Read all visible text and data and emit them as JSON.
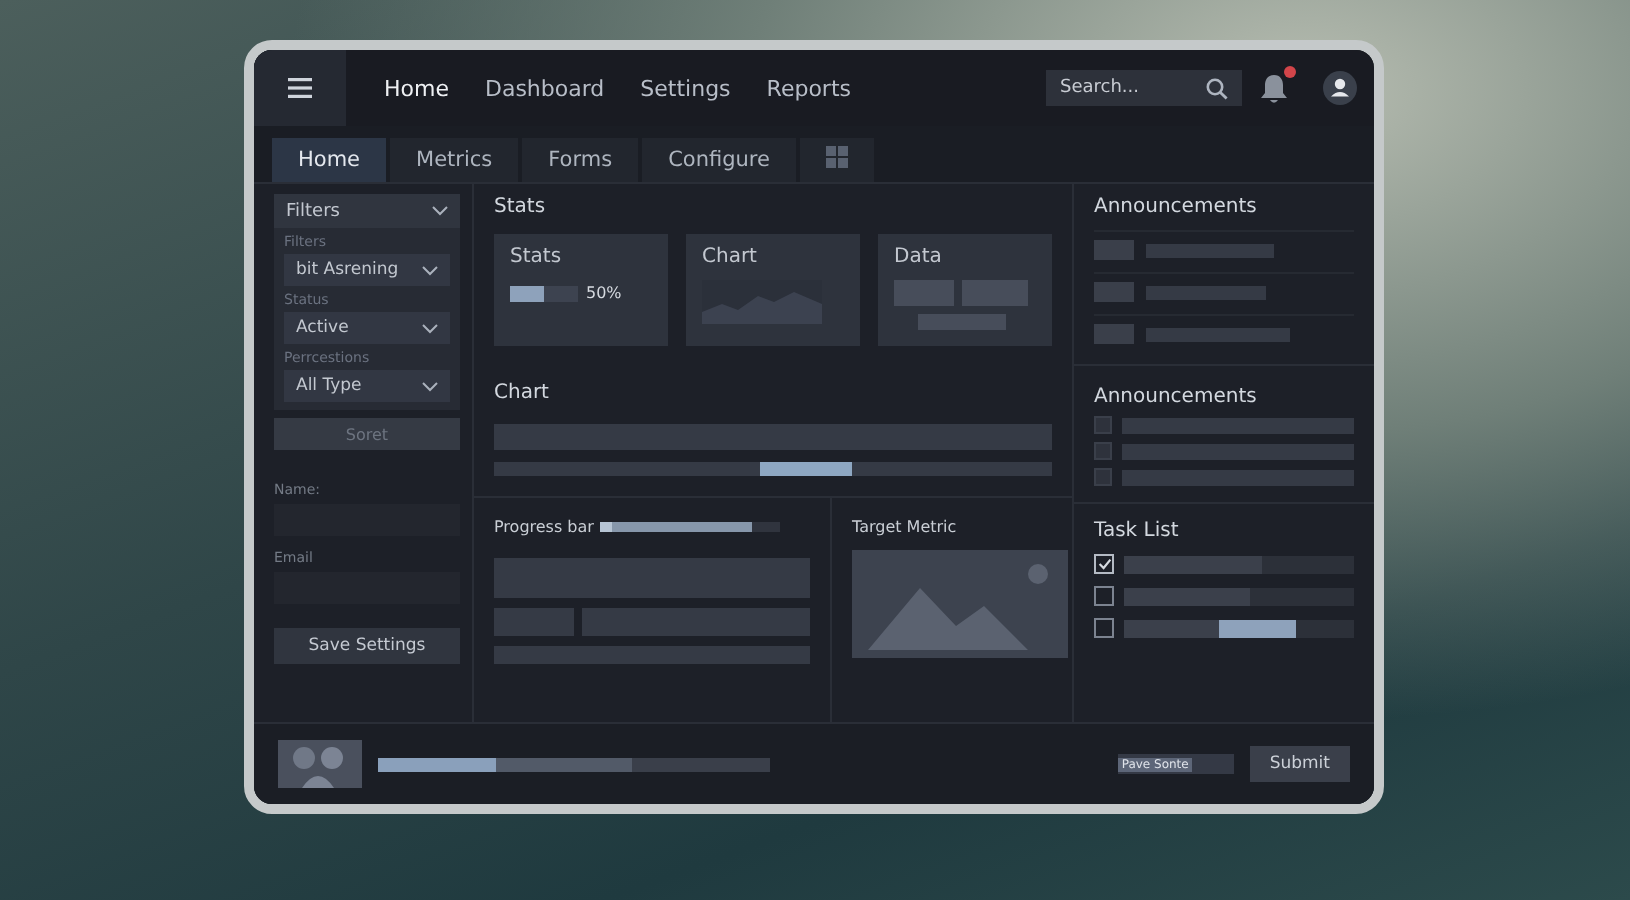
{
  "nav": [
    {
      "label": "Home",
      "selected": true
    },
    {
      "label": "Dashboard",
      "selected": false
    },
    {
      "label": "Settings",
      "selected": false
    },
    {
      "label": "Reports",
      "selected": false
    }
  ],
  "search": {
    "placeholder": "Search..."
  },
  "tabs": [
    {
      "kind": "text",
      "label": "Home",
      "selected": true
    },
    {
      "kind": "text",
      "label": "Metrics",
      "selected": false
    },
    {
      "kind": "text",
      "label": "Forms",
      "selected": false
    },
    {
      "kind": "text",
      "label": "Configure",
      "selected": false
    },
    {
      "kind": "grid",
      "selected": false
    }
  ],
  "sidebar": {
    "dropdown": "Filters",
    "fields": [
      {
        "label": "Filters",
        "value": "bit Asrening"
      },
      {
        "label": "Status",
        "value": "Active"
      },
      {
        "label": "Perrcestions",
        "value": "All Type"
      }
    ],
    "apply_button": "Soret",
    "inputs": [
      {
        "label": "Name:"
      },
      {
        "label": "Email"
      }
    ],
    "save_button": "Save Settings"
  },
  "stats": {
    "title": "Stats",
    "cards": [
      {
        "kind": "progress",
        "title": "Stats",
        "level": 0.5,
        "reading": "50%"
      },
      {
        "kind": "chart",
        "title": "Chart"
      },
      {
        "kind": "data",
        "title": "Data"
      }
    ]
  },
  "chart": {
    "title": "Chart"
  },
  "progress": {
    "label": "Progress bar",
    "level": 0.85
  },
  "target_metric": {
    "title": "Target Metric"
  },
  "announcements": [
    {
      "title": "Announcements"
    },
    {
      "title": "Announcements"
    }
  ],
  "task_list": {
    "title": "Task List",
    "tasks": [
      {
        "checked": true,
        "level": 0.6
      },
      {
        "checked": false,
        "level": 0.55
      },
      {
        "checked": false,
        "level": 0.75
      }
    ]
  },
  "footer": {
    "level": 0.3,
    "tag": "Pave Sonte",
    "submit": "Submit"
  }
}
